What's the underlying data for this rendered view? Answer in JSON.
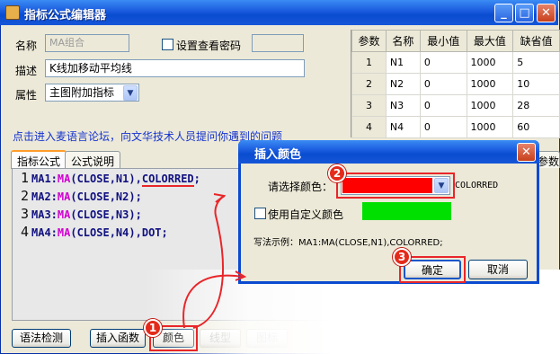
{
  "window": {
    "title": "指标公式编辑器",
    "caption_buttons": [
      "_",
      "□",
      "✕"
    ]
  },
  "form": {
    "name_label": "名称",
    "name_value": "MA组合",
    "password_label": "设置查看密码",
    "desc_label": "描述",
    "desc_value": "K线加移动平均线",
    "attr_label": "属性",
    "attr_value": "主图附加指标"
  },
  "params": {
    "headers": [
      "参数",
      "名称",
      "最小值",
      "最大值",
      "缺省值"
    ],
    "rows": [
      [
        "1",
        "N1",
        "0",
        "1000",
        "5"
      ],
      [
        "2",
        "N2",
        "0",
        "1000",
        "10"
      ],
      [
        "3",
        "N3",
        "0",
        "1000",
        "28"
      ],
      [
        "4",
        "N4",
        "0",
        "1000",
        "60"
      ]
    ]
  },
  "forum_link": "点击进入麦语言论坛，向文华技术人员提问你遇到的问题",
  "tabs": [
    "指标公式",
    "公式说明"
  ],
  "right_tab_fragment": "参数",
  "code": {
    "line_numbers": [
      "1",
      "2",
      "3",
      "4"
    ],
    "lines": [
      {
        "pre": "MA1:",
        "kw": "MA",
        "args": "(CLOSE,N1),",
        "tail": "COLORRED",
        "end": ";"
      },
      {
        "pre": "MA2:",
        "kw": "MA",
        "args": "(CLOSE,N2);",
        "tail": "",
        "end": ""
      },
      {
        "pre": "MA3:",
        "kw": "MA",
        "args": "(CLOSE,N3);",
        "tail": "",
        "end": ""
      },
      {
        "pre": "MA4:",
        "kw": "MA",
        "args": "(CLOSE,N4),",
        "tail": "DOT",
        "end": ";"
      }
    ]
  },
  "bottom_buttons": {
    "syntax": "语法检测",
    "insert_func": "插入函数",
    "color": "颜色",
    "linetype": "线型",
    "icon": "图标"
  },
  "dialog": {
    "title": "插入颜色",
    "select_label": "请选择颜色：",
    "selected_value": "COLORRED",
    "selected_color": "#ff0000",
    "custom_label": "使用自定义颜色",
    "custom_color": "#00e000",
    "example": "写法示例：MA1:MA(CLOSE,N1),COLORRED;",
    "ok": "确定",
    "cancel": "取消"
  },
  "badges": [
    "1",
    "2",
    "3"
  ],
  "icons": [
    "app-icon",
    "dropdown-arrow-icon",
    "close-icon",
    "minimize-icon",
    "maximize-icon"
  ]
}
